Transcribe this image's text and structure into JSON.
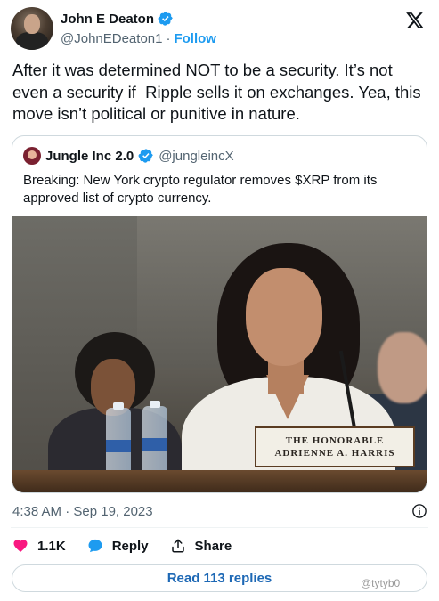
{
  "author": {
    "name": "John E Deaton",
    "handle": "@JohnEDeaton1",
    "separator": "·",
    "follow_label": "Follow",
    "verified_icon": "verified-badge-icon"
  },
  "platform_logo": "x-logo-icon",
  "tweet": {
    "text": "After it was determined NOT to be a security. It’s not even a security if  Ripple sells it on exchanges. Yea, this move isn’t political or punitive in nature."
  },
  "quoted": {
    "name": "Jungle Inc 2.0",
    "handle": "@jungleincX",
    "text": "Breaking: New York crypto regulator removes $XRP from its approved list of crypto currency.",
    "photo": {
      "nameplate_line1": "THE HONORABLE",
      "nameplate_line2": "ADRIENNE A. HARRIS"
    }
  },
  "meta": {
    "timestamp": "4:38 AM · Sep 19, 2023"
  },
  "actions": {
    "like_count": "1.1K",
    "reply_label": "Reply",
    "share_label": "Share"
  },
  "read_replies_label": "Read 113 replies",
  "watermark": "@tytyb0",
  "colors": {
    "accent": "#1d9bf0",
    "like": "#f91880",
    "text": "#0f1419",
    "muted": "#536471"
  }
}
